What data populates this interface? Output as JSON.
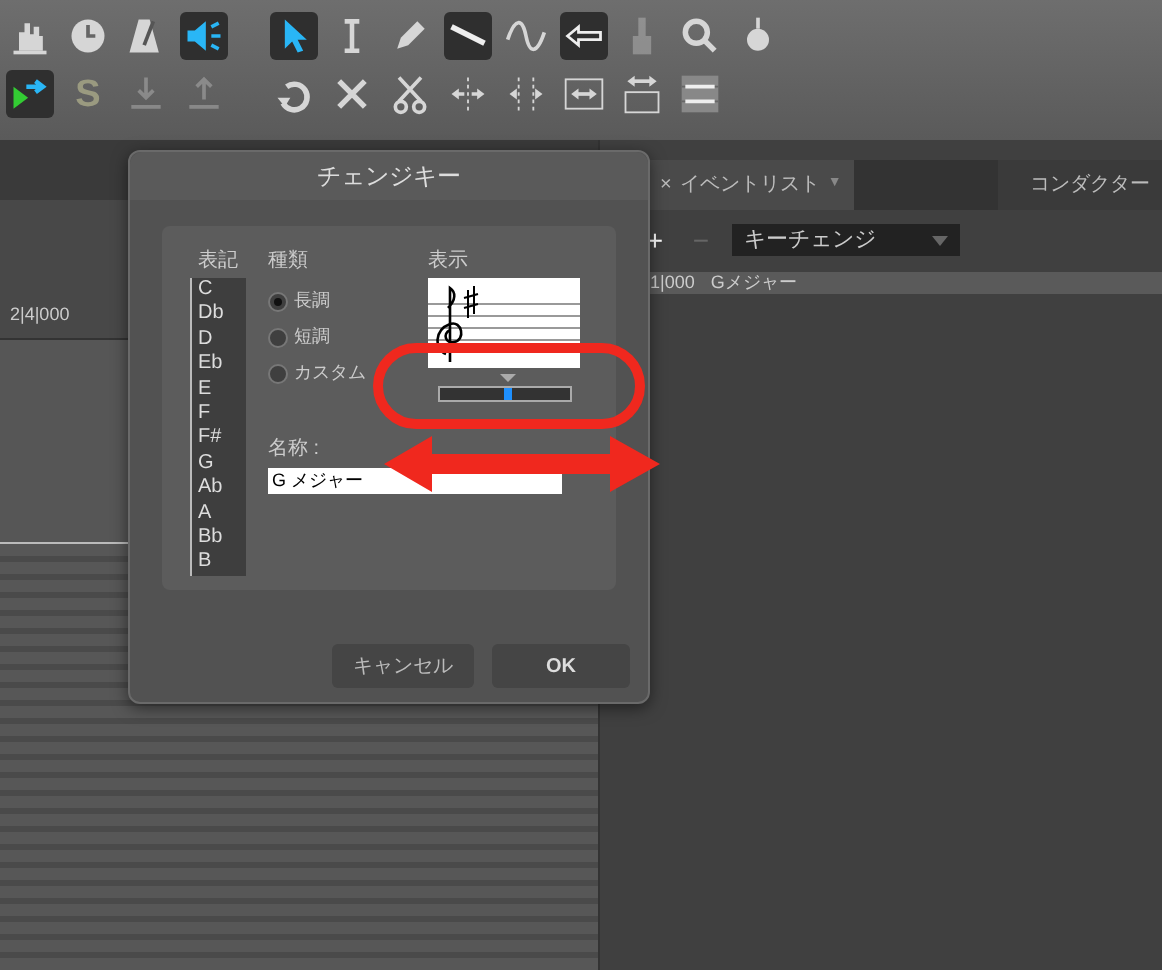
{
  "toolbar": {
    "rows": [
      [
        {
          "on": false,
          "disabled": false
        },
        {
          "on": false,
          "disabled": false
        },
        {
          "on": false,
          "disabled": false
        },
        {
          "on": true,
          "disabled": false
        },
        {
          "on": true,
          "disabled": false
        },
        {
          "on": false,
          "disabled": false
        },
        {
          "on": false,
          "disabled": false
        },
        {
          "on": true,
          "disabled": false
        },
        {
          "on": false,
          "disabled": false
        },
        {
          "on": true,
          "disabled": false
        },
        {
          "on": false,
          "disabled": true
        },
        {
          "on": false,
          "disabled": false
        },
        {
          "on": false,
          "disabled": false
        }
      ],
      [
        {
          "on": true,
          "disabled": false
        },
        {
          "on": false,
          "disabled": false,
          "glyph": "S"
        },
        {
          "on": false,
          "disabled": true
        },
        {
          "on": false,
          "disabled": true
        },
        {
          "on": false,
          "disabled": false
        },
        {
          "on": false,
          "disabled": false
        },
        {
          "on": false,
          "disabled": false
        },
        {
          "on": false,
          "disabled": false
        },
        {
          "on": false,
          "disabled": false
        },
        {
          "on": false,
          "disabled": false
        },
        {
          "on": false,
          "disabled": false
        },
        {
          "on": false,
          "disabled": false
        }
      ]
    ]
  },
  "ruler": {
    "label": "2|4|000"
  },
  "event_panel": {
    "tabs": [
      {
        "label": "イベントリスト",
        "close": "×",
        "menu": "▼",
        "selected": true
      },
      {
        "label": "コンダクター",
        "selected": false
      }
    ],
    "add_button": {
      "label": "+",
      "disabled": false
    },
    "remove_button": {
      "label": "−",
      "disabled": true
    },
    "type_select": {
      "value": "キーチェンジ"
    },
    "events": [
      {
        "position": "1|000",
        "name": "Gメジャー"
      }
    ]
  },
  "dialog": {
    "title": "チェンジキー",
    "key_list": {
      "heading": "表記",
      "items": [
        "C",
        "Db",
        "D",
        "Eb",
        "E",
        "F",
        "F#",
        "G",
        "Ab",
        "A",
        "Bb",
        "B"
      ]
    },
    "key_type": {
      "heading": "種類",
      "options": [
        {
          "label": "長調",
          "selected": true
        },
        {
          "label": "短調",
          "selected": false
        },
        {
          "label": "カスタム",
          "selected": false
        }
      ]
    },
    "preview": {
      "heading": "表示",
      "level": 0.52
    },
    "name": {
      "label": "名称 :",
      "value": "G メジャー"
    },
    "buttons": [
      {
        "label": "キャンセル",
        "kind": "secondary"
      },
      {
        "label": "OK",
        "kind": "primary"
      }
    ]
  }
}
